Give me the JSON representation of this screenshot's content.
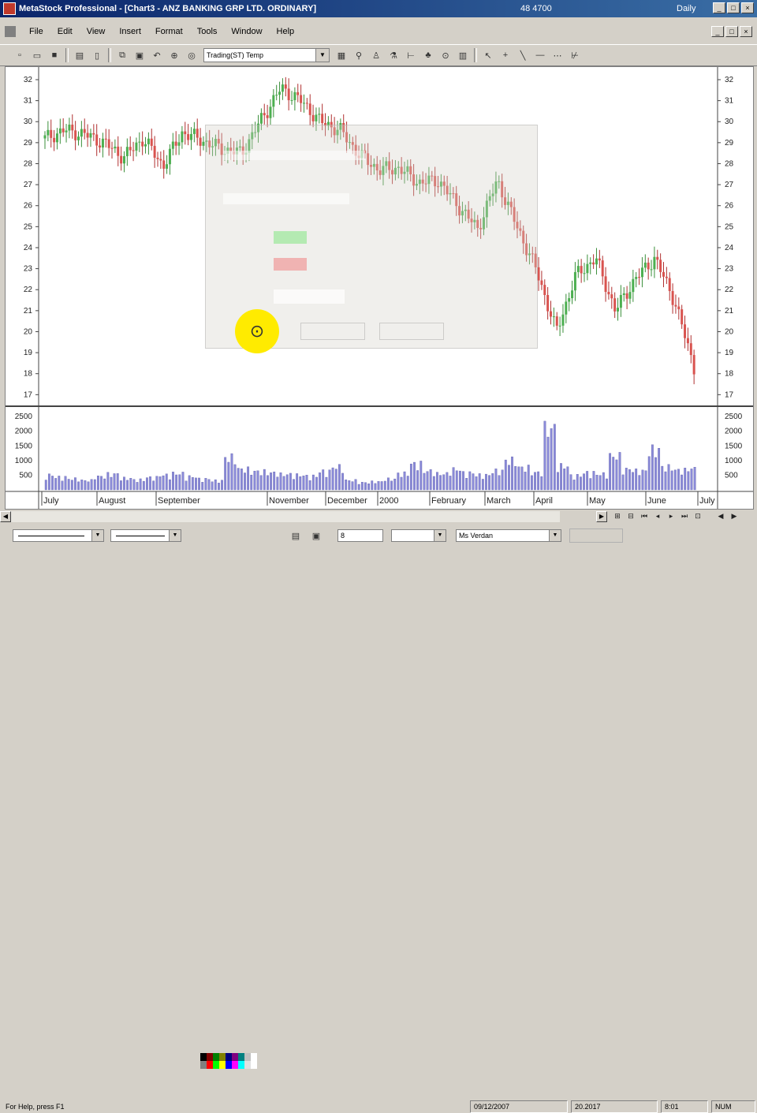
{
  "window": {
    "title": "MetaStock Professional - [Chart3 - ANZ BANKING GRP LTD. ORDINARY]",
    "center_text": "48 4700",
    "interval": "Daily",
    "buttons": [
      "_",
      "□",
      "×"
    ]
  },
  "menu": [
    "File",
    "Edit",
    "View",
    "Insert",
    "Format",
    "Tools",
    "Window",
    "Help"
  ],
  "toolbar": {
    "template_value": "Trading(ST) Temp"
  },
  "chart_data": {
    "type": "line",
    "price_axis": {
      "ticks": [
        32,
        31,
        30,
        29,
        28,
        27,
        26,
        25,
        24,
        23,
        22,
        21,
        20,
        19,
        18,
        17
      ],
      "range": [
        16.9,
        32.3
      ]
    },
    "volume_axis": {
      "ticks": [
        2500,
        2000,
        1500,
        1000,
        500
      ],
      "range": [
        0,
        2800
      ]
    },
    "x_labels": [
      "July",
      "August",
      "September",
      "November",
      "December",
      "2000",
      "February",
      "March",
      "April",
      "May",
      "June",
      "July"
    ],
    "price_series": [
      29.2,
      29.6,
      29.4,
      29.0,
      28.3,
      29.2,
      27.9,
      29.5,
      29.1,
      28.7,
      28.5,
      30.1,
      31.6,
      31.0,
      30.0,
      29.6,
      28.4,
      27.7,
      27.8,
      27.1,
      27.2,
      26.0,
      24.9,
      27.2,
      25.0,
      22.9,
      20.0,
      22.7,
      23.5,
      21.0,
      22.5,
      23.5,
      21.5,
      18.3
    ],
    "volume_series": [
      560,
      480,
      420,
      360,
      510,
      600,
      440,
      380,
      470,
      560,
      620,
      500,
      410,
      350,
      1240,
      790,
      700,
      650,
      590,
      560,
      520,
      700,
      880,
      360,
      280,
      310,
      410,
      620,
      990,
      720,
      610,
      780,
      640,
      560,
      720,
      1130,
      850,
      660,
      2350,
      910,
      540,
      650,
      600,
      1290,
      780,
      720,
      1540,
      870,
      750,
      810
    ]
  },
  "objects_bar": {
    "line_style": "",
    "line_weight": "",
    "font_size": "8",
    "font_name": "Ms Verdan",
    "extra": ""
  },
  "status": {
    "help": "For Help, press F1",
    "date": "09/12/2007",
    "value": "20.2017",
    "time": "8:01",
    "mode": "NUM"
  }
}
